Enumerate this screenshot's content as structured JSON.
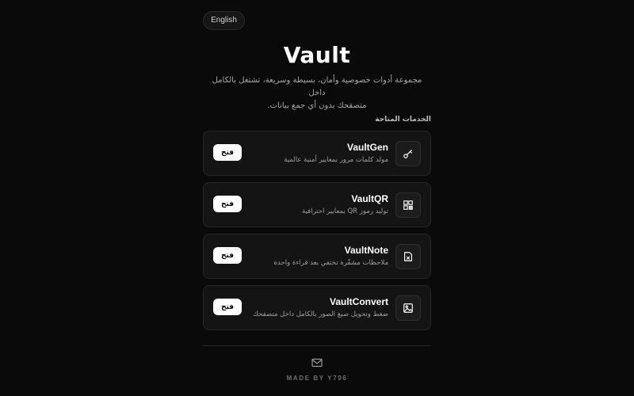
{
  "language_button": "English",
  "title": "Vault",
  "description_line1": "مجموعة أدوات خصوصية وأمان، بسيطة وسريعة، تشتغل بالكامل داخل",
  "description_line2": "متصفحك بدون أي جمع بيانات.",
  "section_title": "الخدمات المتاحة",
  "services": [
    {
      "name": "VaultGen",
      "description": "مولد كلمات مرور بمعايير أمنية عالمية",
      "open_label": "فتح",
      "icon": "key-icon"
    },
    {
      "name": "VaultQR",
      "description": "توليد رموز QR بمعايير احترافية",
      "open_label": "فتح",
      "icon": "qr-code-icon"
    },
    {
      "name": "VaultNote",
      "description": "ملاحظات مشفّرة تختفي بعد قراءة واحدة",
      "open_label": "فتح",
      "icon": "note-icon"
    },
    {
      "name": "VaultConvert",
      "description": "ضغط وتحويل صيغ الصور بالكامل داخل متصفحك",
      "open_label": "فتح",
      "icon": "image-icon"
    }
  ],
  "footer": {
    "icon": "mail-icon",
    "text": "MADE BY Y796"
  }
}
